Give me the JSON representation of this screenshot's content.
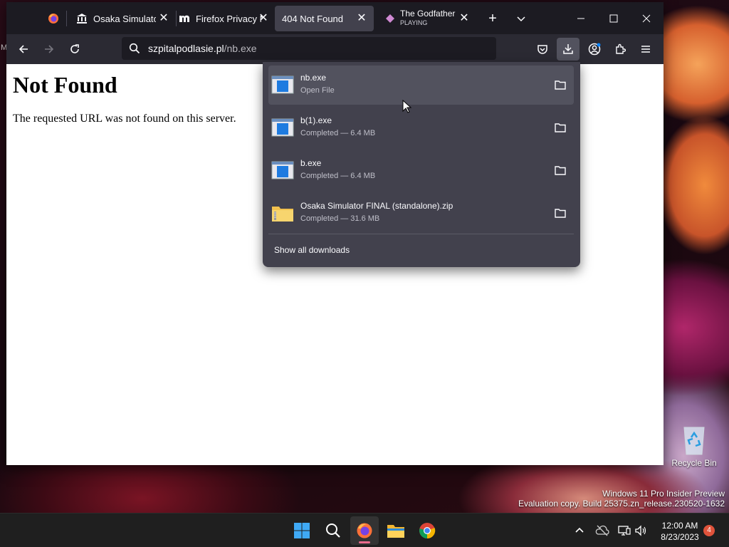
{
  "browser": {
    "tabs": [
      {
        "title": "",
        "favicon": "firefox-icon"
      },
      {
        "title": "Osaka Simulator",
        "favicon": "museum-icon"
      },
      {
        "title": "Firefox Privacy N",
        "favicon": "m-logo-icon"
      },
      {
        "title": "404 Not Found",
        "favicon": "",
        "active": true
      },
      {
        "title": "The Godfather",
        "subtitle": "PLAYING",
        "favicon": "diamond-icon"
      }
    ],
    "url": {
      "host": "szpitalpodlasie.pl",
      "path": "/nb.exe"
    }
  },
  "page": {
    "heading": "Not Found",
    "message": "The requested URL was not found on this server."
  },
  "downloads": {
    "items": [
      {
        "name": "nb.exe",
        "status": "Open File",
        "icon": "exe-icon"
      },
      {
        "name": "b(1).exe",
        "status": "Completed — 6.4 MB",
        "icon": "exe-icon"
      },
      {
        "name": "b.exe",
        "status": "Completed — 6.4 MB",
        "icon": "exe-icon"
      },
      {
        "name": "Osaka Simulator FINAL (standalone).zip",
        "status": "Completed — 31.6 MB",
        "icon": "zip-folder-icon"
      }
    ],
    "show_all": "Show all downloads"
  },
  "desktop": {
    "recycle_bin": "Recycle Bin",
    "left_sliver": "M",
    "watermark_line1": "Windows 11 Pro Insider Preview",
    "watermark_line2": "Evaluation copy. Build 25375.zn_release.230520-1632"
  },
  "taskbar": {
    "time": "12:00 AM",
    "date": "8/23/2023",
    "notifications": "4"
  },
  "colors": {
    "accent": "#0a84ff",
    "panel": "#42414d",
    "toolbar": "#2b2a33",
    "tabbar": "#1c1b22"
  }
}
